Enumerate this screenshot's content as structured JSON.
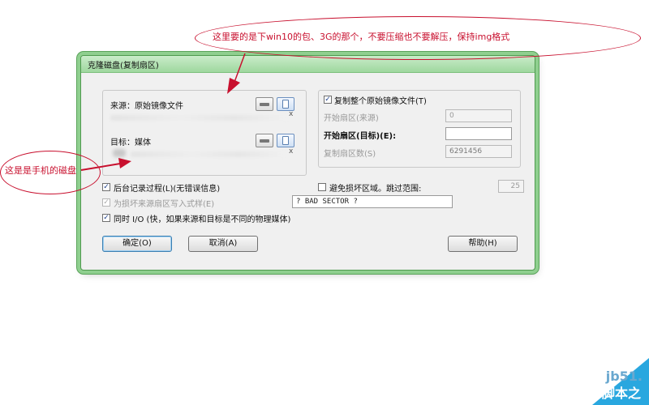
{
  "dialog": {
    "title": "克隆磁盘(复制扇区)",
    "source": {
      "label": "来源：原始镜像文件",
      "path_char": "x"
    },
    "target": {
      "label": "目标：媒体",
      "path_char": "x"
    },
    "copy_whole": {
      "label": "复制整个原始镜像文件(T)",
      "checked": true
    },
    "start_source": {
      "label": "开始扇区(来源)",
      "value": "0"
    },
    "start_target": {
      "label": "开始扇区(目标)(E):",
      "value": ""
    },
    "sector_count": {
      "label": "复制扇区数(S)",
      "value": "6291456"
    },
    "log_process": {
      "label": "后台记录过程(L)(无错误信息)",
      "checked": true
    },
    "avoid_bad": {
      "label": "避免损坏区域。跳过范围:",
      "checked": false,
      "value": "25"
    },
    "write_pattern": {
      "label": "为损坏来源扇区写入式样(E)",
      "checked": true,
      "value": "? BAD SECTOR ?"
    },
    "simultaneous_io": {
      "label": "同时 I/O (快，如果来源和目标是不同的物理媒体)",
      "checked": true
    },
    "buttons": {
      "ok": "确定(O)",
      "cancel": "取消(A)",
      "help": "帮助(H)"
    }
  },
  "annotations": {
    "top": "这里要的是下win10的包、3G的那个，不要压缩也不要解压，保持img格式",
    "left": "这是是手机的磁盘"
  },
  "watermark": {
    "top": "jb51.",
    "bottom": "脚本之"
  },
  "colors": {
    "annotation": "#c8102e",
    "window_border": "#8fcf8f",
    "watermark_blue": "#29a7df"
  }
}
